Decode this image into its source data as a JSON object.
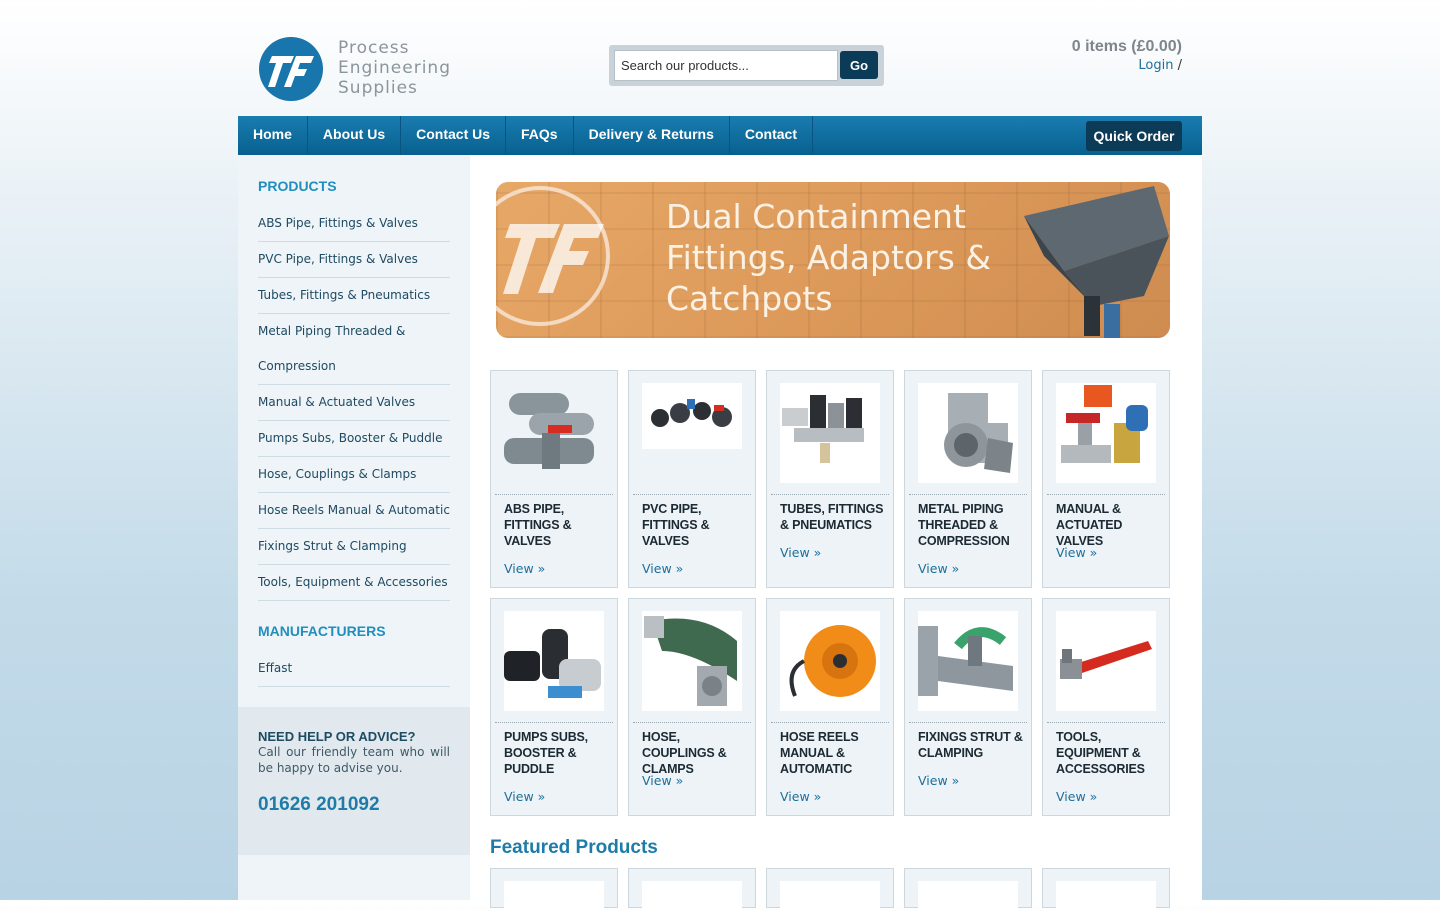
{
  "header": {
    "logo_lines": [
      "Process",
      "Engineering",
      "Supplies"
    ],
    "search": {
      "placeholder": "Search our products...",
      "button_label": "Go"
    },
    "cart": {
      "summary": "0 items (£0.00)",
      "login_label": "Login",
      "separator": "/"
    }
  },
  "nav": {
    "items": [
      {
        "label": "Home"
      },
      {
        "label": "About Us"
      },
      {
        "label": "Contact Us"
      },
      {
        "label": "FAQs"
      },
      {
        "label": "Delivery & Returns"
      },
      {
        "label": "Contact"
      }
    ],
    "quick_order_label": "Quick Order"
  },
  "sidebar": {
    "products_heading": "PRODUCTS",
    "products": [
      "ABS Pipe, Fittings & Valves",
      "PVC Pipe, Fittings & Valves",
      "Tubes, Fittings & Pneumatics",
      "Metal Piping Threaded & Compression",
      "Manual & Actuated Valves",
      "Pumps Subs, Booster & Puddle",
      "Hose, Couplings & Clamps",
      "Hose Reels Manual & Automatic",
      "Fixings Strut & Clamping",
      "Tools, Equipment & Accessories"
    ],
    "manufacturers_heading": "MANUFACTURERS",
    "manufacturers": [
      "Effast"
    ],
    "help": {
      "title": "NEED HELP OR ADVICE?",
      "text": "Call our friendly team who will be happy to advise you.",
      "phone": "01626 201092"
    }
  },
  "banner": {
    "lines": [
      "Dual Containment",
      "Fittings, Adaptors &",
      "Catchpots"
    ]
  },
  "categories": [
    {
      "title": "ABS Pipe, Fittings & Valves",
      "view": "View »",
      "icon": "abs-pipe-icon"
    },
    {
      "title": "PVC Pipe, Fittings & Valves",
      "view": "View »",
      "icon": "pvc-fittings-icon"
    },
    {
      "title": "Tubes, Fittings & Pneumatics",
      "view": "View »",
      "icon": "pneumatics-icon"
    },
    {
      "title": "Metal Piping Threaded & Compression",
      "view": "View »",
      "icon": "metal-fitting-icon"
    },
    {
      "title": "Manual & Actuated Valves",
      "view": "View »",
      "icon": "valve-icon"
    },
    {
      "title": "Pumps Subs, Booster & Puddle",
      "view": "View »",
      "icon": "pump-icon"
    },
    {
      "title": "Hose, Couplings & Clamps",
      "view": "View »",
      "icon": "hose-icon"
    },
    {
      "title": "Hose Reels Manual & Automatic",
      "view": "View »",
      "icon": "hose-reel-icon"
    },
    {
      "title": "Fixings Strut & Clamping",
      "view": "View »",
      "icon": "strut-icon"
    },
    {
      "title": "Tools, Equipment & Accessories",
      "view": "View »",
      "icon": "wrench-icon"
    }
  ],
  "featured": {
    "heading": "Featured Products"
  },
  "colors": {
    "accent": "#1f7ca8",
    "nav": "#0c6b9c",
    "button_dark": "#0c3b57"
  }
}
